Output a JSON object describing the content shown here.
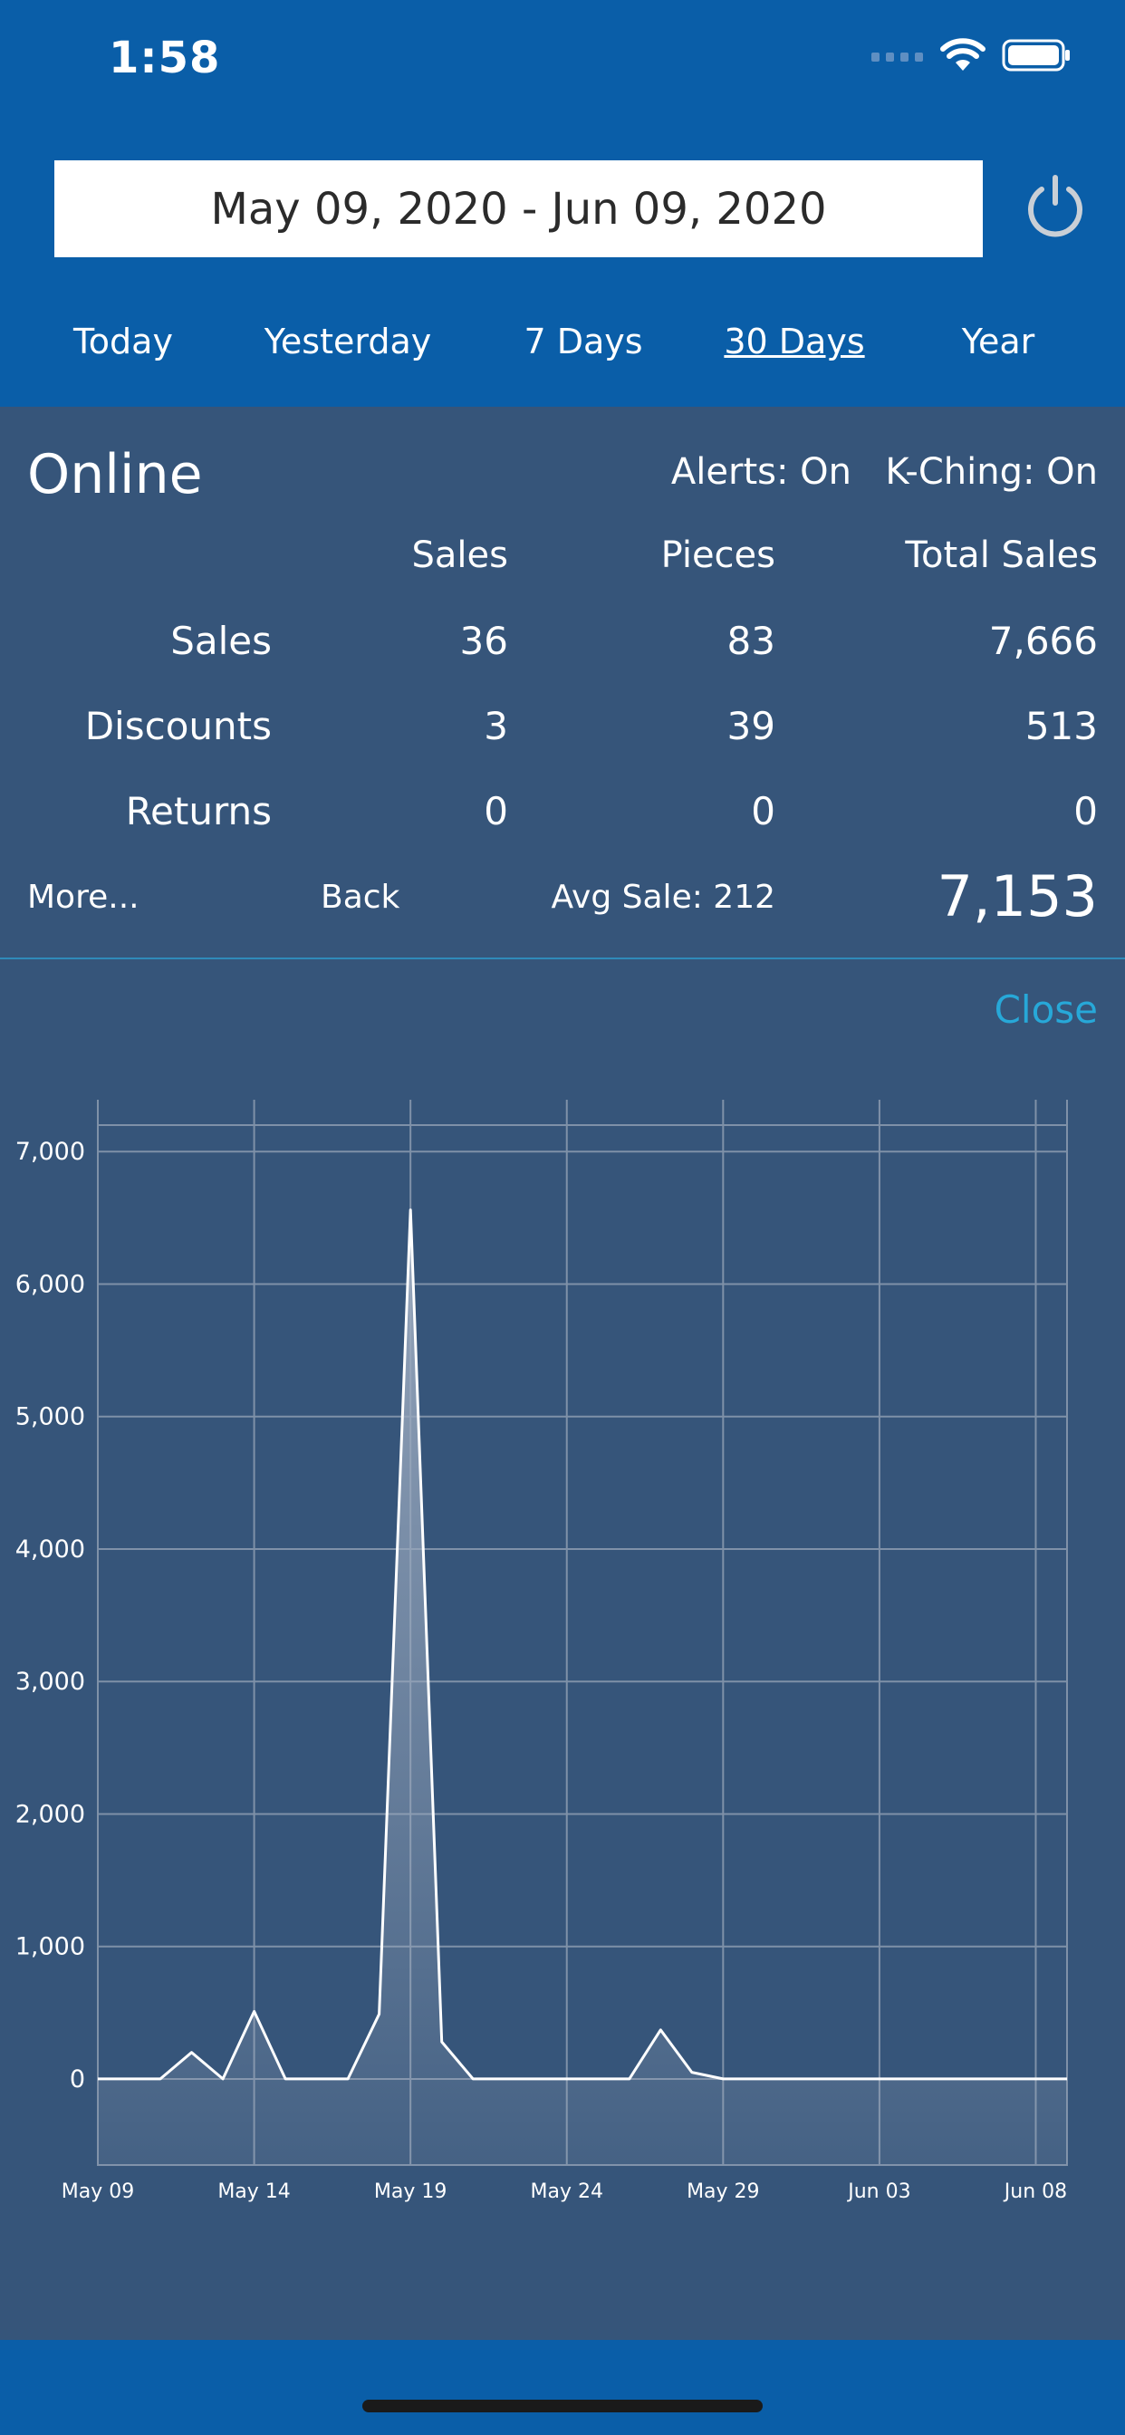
{
  "status": {
    "time": "1:58"
  },
  "header": {
    "date_range": "May 09, 2020  -  Jun 09, 2020",
    "power_icon": "power-icon"
  },
  "range_tabs": [
    {
      "label": "Today",
      "active": false
    },
    {
      "label": "Yesterday",
      "active": false
    },
    {
      "label": "7 Days",
      "active": false
    },
    {
      "label": "30 Days",
      "active": true
    },
    {
      "label": "Year",
      "active": false
    }
  ],
  "summary": {
    "title": "Online",
    "alerts": "Alerts: On",
    "kching": "K-Ching: On",
    "columns": [
      "Sales",
      "Pieces",
      "Total Sales"
    ],
    "rows": [
      {
        "label": "Sales",
        "values": [
          "36",
          "83",
          "7,666"
        ]
      },
      {
        "label": "Discounts",
        "values": [
          "3",
          "39",
          "513"
        ]
      },
      {
        "label": "Returns",
        "values": [
          "0",
          "0",
          "0"
        ]
      }
    ],
    "more": "More...",
    "back": "Back",
    "avg_sale": "Avg Sale: 212",
    "grand_total": "7,153"
  },
  "close_label": "Close",
  "chart_data": {
    "type": "area",
    "x": [
      "May 09",
      "May 10",
      "May 11",
      "May 12",
      "May 13",
      "May 14",
      "May 15",
      "May 16",
      "May 17",
      "May 18",
      "May 19",
      "May 20",
      "May 21",
      "May 22",
      "May 23",
      "May 24",
      "May 25",
      "May 26",
      "May 27",
      "May 28",
      "May 29",
      "May 30",
      "May 31",
      "Jun 01",
      "Jun 02",
      "Jun 03",
      "Jun 04",
      "Jun 05",
      "Jun 06",
      "Jun 07",
      "Jun 08",
      "Jun 09"
    ],
    "values": [
      0,
      0,
      0,
      200,
      0,
      510,
      0,
      0,
      0,
      490,
      6560,
      280,
      0,
      0,
      0,
      0,
      0,
      0,
      370,
      50,
      0,
      0,
      0,
      0,
      0,
      0,
      0,
      0,
      0,
      0,
      0,
      0
    ],
    "xticks": [
      "May 09",
      "May 14",
      "May 19",
      "May 24",
      "May 29",
      "Jun 03",
      "Jun 08"
    ],
    "yticks": [
      "0",
      "1,000",
      "2,000",
      "3,000",
      "4,000",
      "5,000",
      "6,000",
      "7,000"
    ],
    "ylim": [
      -650,
      7200
    ],
    "grid": true,
    "line_color": "#ffffff",
    "fill_color": "#9aa9be"
  }
}
